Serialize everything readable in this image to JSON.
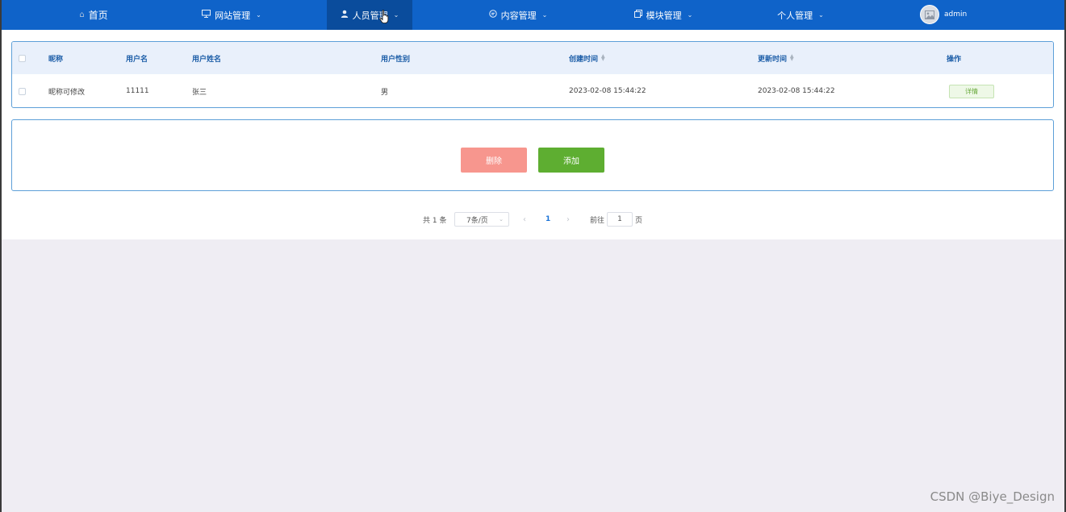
{
  "nav": {
    "items": [
      {
        "label": "首页",
        "icon": "home-icon"
      },
      {
        "label": "网站管理",
        "icon": "monitor-icon"
      },
      {
        "label": "人员管理",
        "icon": "user-icon"
      },
      {
        "label": "内容管理",
        "icon": "chat-icon"
      },
      {
        "label": "模块管理",
        "icon": "copy-icon"
      },
      {
        "label": "个人管理",
        "icon": ""
      }
    ],
    "active_index": 2,
    "user": "admin"
  },
  "table": {
    "columns": [
      "昵称",
      "用户名",
      "用户姓名",
      "用户性别",
      "创建时间",
      "更新时间",
      "操作"
    ],
    "rows": [
      {
        "nickname": "昵称可修改",
        "username": "11111",
        "real_name": "张三",
        "gender": "男",
        "created": "2023-02-08 15:44:22",
        "updated": "2023-02-08 15:44:22",
        "action": "详情"
      }
    ]
  },
  "actions": {
    "delete_label": "删除",
    "add_label": "添加"
  },
  "pagination": {
    "total": "共 1 条",
    "page_size": "7条/页",
    "current_page": "1",
    "goto_label": "前往",
    "goto_value": "1",
    "page_unit": "页"
  },
  "watermark": "CSDN @Biye_Design",
  "colors": {
    "nav_bg": "#0f63c9",
    "nav_active_bg": "#0a4c9c",
    "delete_btn": "#f7968e",
    "add_btn": "#5eae31",
    "page_bg": "#efedf3"
  }
}
